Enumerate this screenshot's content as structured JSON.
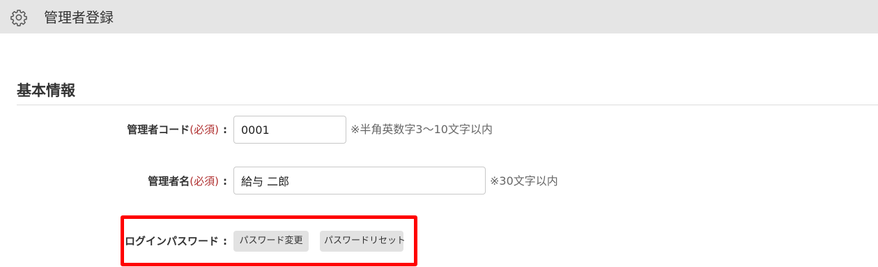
{
  "header": {
    "title": "管理者登録",
    "icon": "gear-icon"
  },
  "section": {
    "title": "基本情報"
  },
  "form": {
    "admin_code": {
      "label": "管理者コード",
      "required": "(必須)",
      "colon": ":",
      "value": "0001",
      "note": "※半角英数字3～10文字以内"
    },
    "admin_name": {
      "label": "管理者名",
      "required": "(必須)",
      "colon": ":",
      "value": "給与 二郎",
      "note": "※30文字以内"
    },
    "login_password": {
      "label": "ログインパスワード",
      "colon": ":",
      "change_button": "パスワード変更",
      "reset_button": "パスワードリセット"
    }
  },
  "colors": {
    "header_bg": "#e5e5e5",
    "required": "#b03030",
    "highlight_border": "#ff0000",
    "button_bg": "#e2e2e2"
  }
}
